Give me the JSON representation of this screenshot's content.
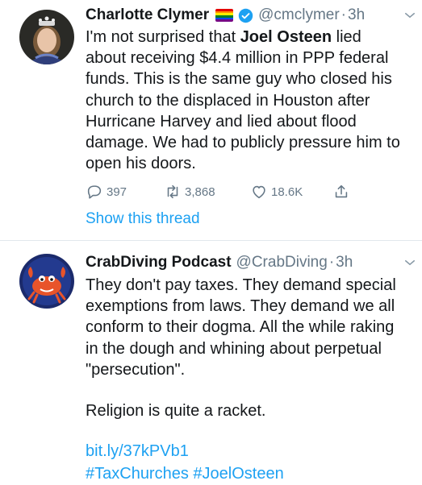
{
  "tweets": [
    {
      "author_name": "Charlotte Clymer",
      "handle": "@cmclymer",
      "separator": "·",
      "time": "3h",
      "text_pre": "I'm not surprised that ",
      "text_bold": "Joel Osteen",
      "text_post": " lied about receiving $4.4 million in PPP federal funds. This is the same guy who closed his church to the displaced in Houston after Hurricane Harvey and lied about flood damage. We had to publicly pressure him to open his doors.",
      "stats": {
        "replies": "397",
        "retweets": "3,868",
        "likes": "18.6K"
      },
      "show_thread": "Show this thread",
      "flag_colors": [
        "#e40303",
        "#ff8c00",
        "#ffed00",
        "#008026",
        "#004dff",
        "#750787"
      ],
      "verified_color": "#1da1f2",
      "icons": [
        "reply-icon",
        "retweet-icon",
        "like-icon",
        "share-icon",
        "verified-icon",
        "chevron-down-icon"
      ]
    },
    {
      "author_name": "CrabDiving Podcast",
      "handle": "@CrabDiving",
      "separator": "·",
      "time": "3h",
      "text": "They don't pay taxes. They demand special exemptions from laws. They demand we all conform to their dogma. All the while raking in the dough and whining about perpetual \"persecution\".",
      "text_2": "Religion is quite a racket.",
      "link": "bit.ly/37kPVb1",
      "hashtags": "#TaxChurches #JoelOsteen",
      "icons": [
        "chevron-down-icon"
      ]
    }
  ],
  "colors": {
    "link": "#1da1f2",
    "secondary_text": "#657786",
    "divider": "#e1e8ed"
  }
}
